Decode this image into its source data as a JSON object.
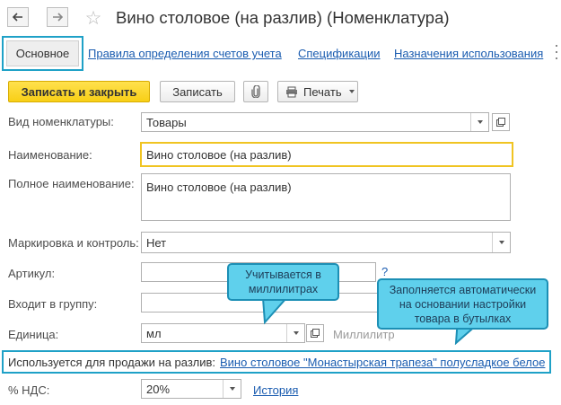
{
  "window": {
    "title": "Вино столовое (на разлив) (Номенклатура)",
    "back_icon": "arrow-left-icon",
    "forward_icon": "arrow-right-icon",
    "favorite_icon": "star-icon"
  },
  "tabs": [
    {
      "label": "Основное",
      "active": true
    },
    {
      "label": "Правила определения счетов учета"
    },
    {
      "label": "Спецификации"
    },
    {
      "label": "Назначения использования"
    }
  ],
  "toolbar": {
    "save_close_label": "Записать и закрыть",
    "save_label": "Записать",
    "attach_icon": "paperclip-icon",
    "print_label": "Печать",
    "print_icon": "printer-icon"
  },
  "form": {
    "kind_label": "Вид номенклатуры:",
    "kind_value": "Товары",
    "name_label": "Наименование:",
    "name_value": "Вино столовое (на разлив)",
    "fullname_label": "Полное наименование:",
    "fullname_value": "Вино столовое (на разлив)",
    "marking_label": "Маркировка и контроль:",
    "marking_value": "Нет",
    "article_label": "Артикул:",
    "article_value": "",
    "article_help": "?",
    "group_label": "Входит в группу:",
    "group_value": "",
    "unit_label": "Единица:",
    "unit_value": "мл",
    "unit_hint": "Миллилитр",
    "bottling_label": "Используется для продажи на разлив:",
    "bottling_link": "Вино столовое \"Монастырская трапеза\" полусладкое белое",
    "vat_label": "% НДС:",
    "vat_value": "20%",
    "history_link": "История"
  },
  "callouts": {
    "unit_note": "Учитывается в миллилитрах",
    "auto_note": "Заполняется автоматически на основании настройки товара в бутылках"
  },
  "colors": {
    "accent": "#1fa1c7",
    "primary_button": "#f8cf16",
    "link": "#1a5cb0",
    "callout_fill": "#5fd0ec",
    "focus_border": "#f0c422"
  }
}
